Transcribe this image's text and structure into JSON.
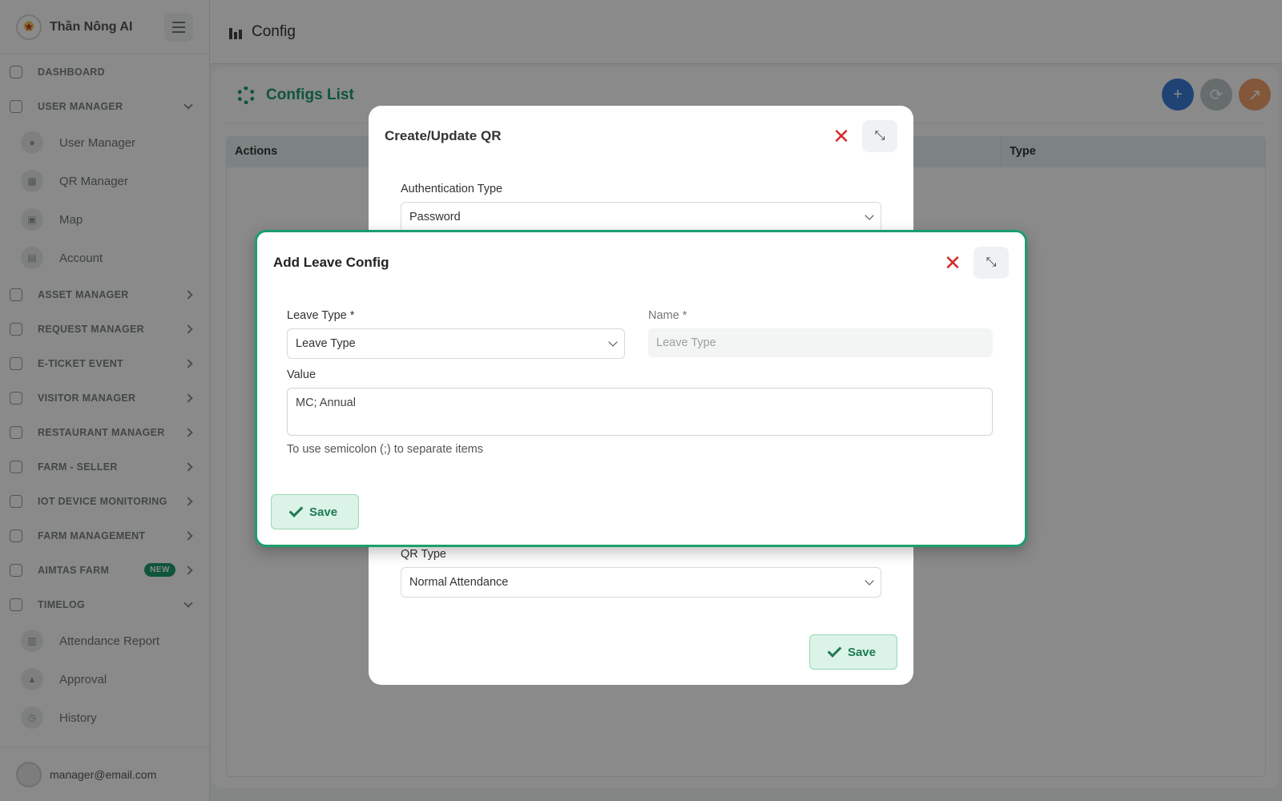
{
  "brand": {
    "name": "Thần Nông AI"
  },
  "nav": {
    "dashboard": "DASHBOARD",
    "user_manager": "USER MANAGER",
    "user_manager_items": [
      "User Manager",
      "QR Manager",
      "Map",
      "Account"
    ],
    "asset_manager": "ASSET MANAGER",
    "request_manager": "REQUEST MANAGER",
    "eticket_event": "E-TICKET EVENT",
    "visitor_manager": "VISITOR MANAGER",
    "restaurant_manager": "RESTAURANT MANAGER",
    "farm_seller": "FARM - SELLER",
    "iot_device_monitoring": "IOT DEVICE MONITORING",
    "farm_management": "FARM MANAGEMENT",
    "aimtas_farm": "AIMTAS FARM",
    "aimtas_badge": "NEW",
    "timelog": "TIMELOG",
    "timelog_items": [
      "Attendance Report",
      "Approval",
      "History"
    ]
  },
  "user": {
    "email": "manager@email.com"
  },
  "topbar": {
    "title": "Config"
  },
  "card": {
    "title": "Configs List"
  },
  "table": {
    "columns": [
      "Actions",
      "Type"
    ]
  },
  "qr_modal": {
    "title": "Create/Update QR",
    "auth_label": "Authentication Type",
    "auth_value": "Password",
    "qr_type_label": "QR Type",
    "qr_type_value": "Normal Attendance",
    "save_label": "Save"
  },
  "leave_modal": {
    "title": "Add Leave Config",
    "leave_type_label": "Leave Type",
    "leave_type_value": "Leave Type",
    "name_label": "Name",
    "name_placeholder": "Leave Type",
    "required_mark": "*",
    "value_label": "Value",
    "value_text": "MC; Annual",
    "hint": "To use semicolon (;) to separate items",
    "save_label": "Save"
  },
  "colors": {
    "accent": "#1b9e6d",
    "danger": "#d62b2b",
    "blue": "#3c7dd9"
  }
}
